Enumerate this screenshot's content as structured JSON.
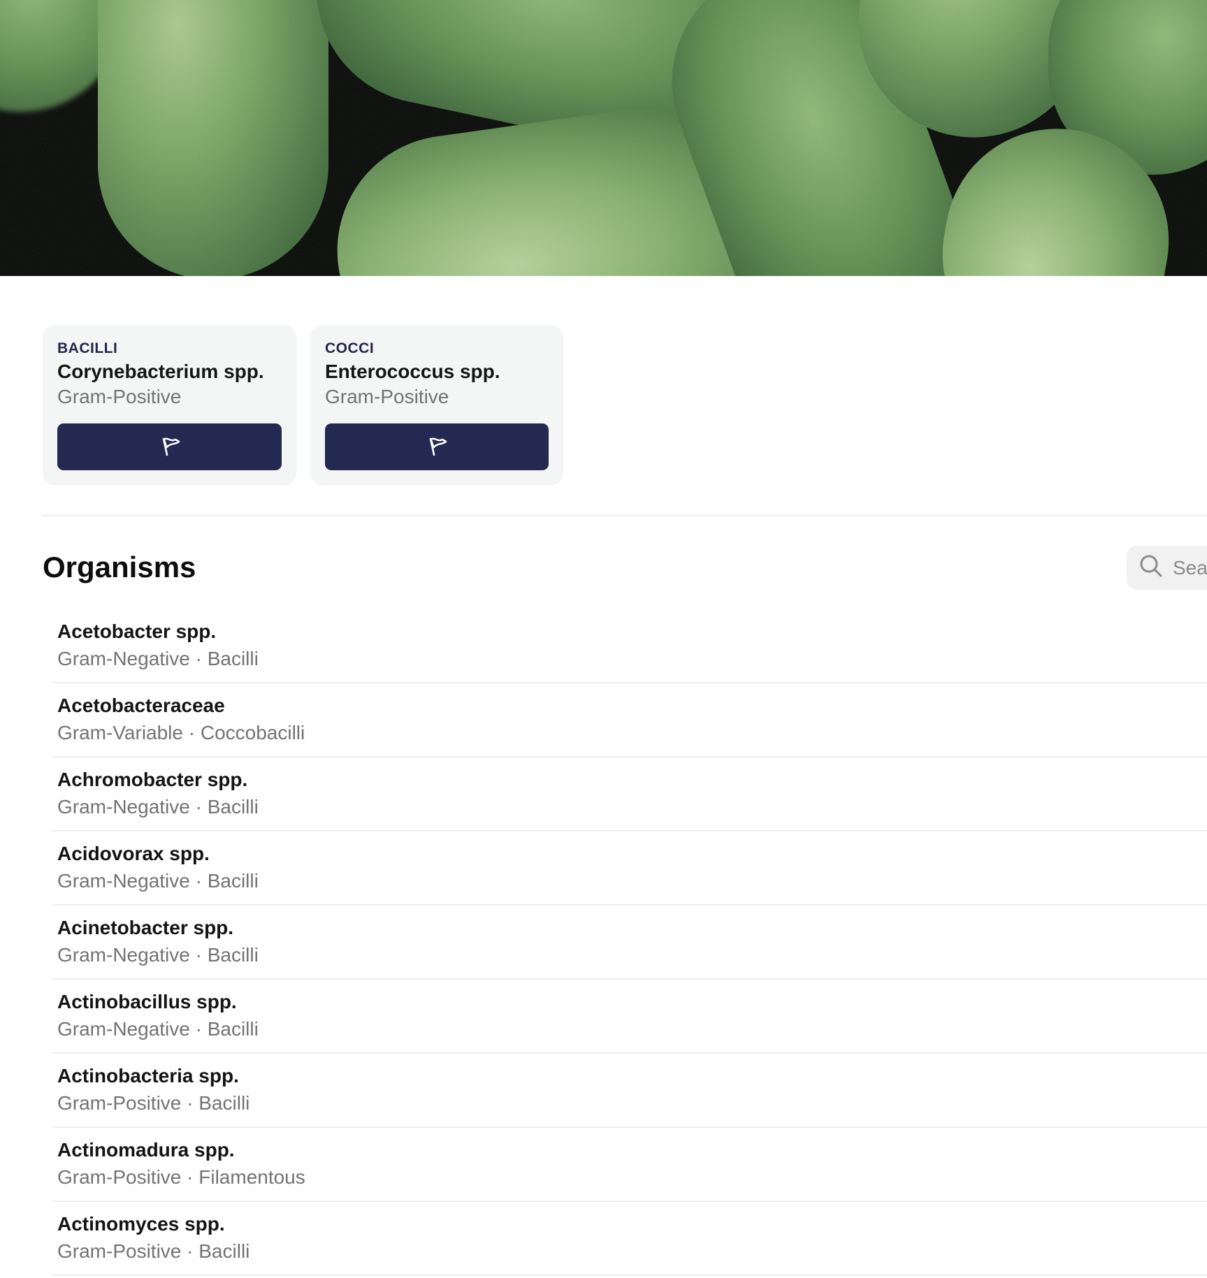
{
  "hero": {
    "icon": "bacteria-image"
  },
  "featured": [
    {
      "category": "BACILLI",
      "name": "Corynebacterium spp.",
      "gram": "Gram-Positive",
      "button_icon": "flag-icon"
    },
    {
      "category": "COCCI",
      "name": "Enterococcus spp.",
      "gram": "Gram-Positive",
      "button_icon": "flag-icon"
    }
  ],
  "organisms": {
    "title": "Organisms",
    "search": {
      "placeholder": "Search",
      "icon": "search-icon"
    },
    "items": [
      {
        "name": "Acetobacter spp.",
        "meta": "Gram-Negative · Bacilli"
      },
      {
        "name": "Acetobacteraceae",
        "meta": "Gram-Variable · Coccobacilli"
      },
      {
        "name": "Achromobacter spp.",
        "meta": "Gram-Negative · Bacilli"
      },
      {
        "name": "Acidovorax spp.",
        "meta": "Gram-Negative · Bacilli"
      },
      {
        "name": "Acinetobacter spp.",
        "meta": "Gram-Negative · Bacilli"
      },
      {
        "name": "Actinobacillus spp.",
        "meta": "Gram-Negative · Bacilli"
      },
      {
        "name": "Actinobacteria spp.",
        "meta": "Gram-Positive · Bacilli"
      },
      {
        "name": "Actinomadura spp.",
        "meta": "Gram-Positive · Filamentous"
      },
      {
        "name": "Actinomyces spp.",
        "meta": "Gram-Positive · Bacilli"
      }
    ]
  },
  "colors": {
    "button": "#232950",
    "card_background": "#f4f5f5",
    "bacteria_green": "#6f9a58",
    "muted_text": "#737373"
  }
}
